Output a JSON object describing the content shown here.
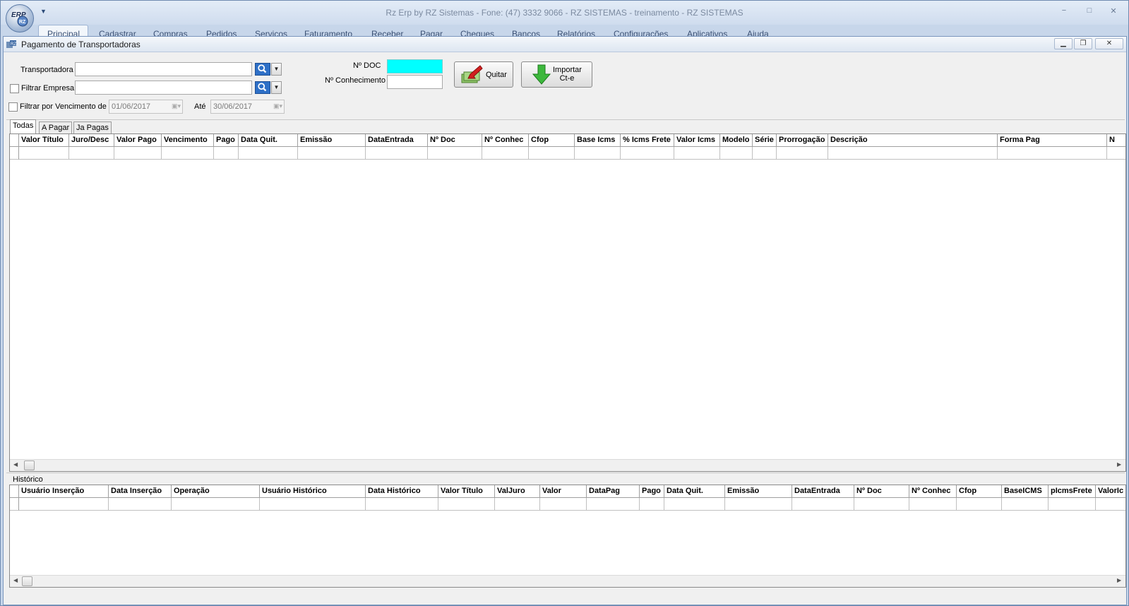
{
  "app": {
    "title": "Rz Erp by RZ Sistemas - Fone: (47) 3332 9066 - RZ SISTEMAS - treinamento - RZ SISTEMAS",
    "ribbon_tabs": [
      "Principal",
      "Cadastrar",
      "Compras",
      "Pedidos",
      "Serviços",
      "Faturamento",
      "Receber",
      "Pagar",
      "Cheques",
      "Bancos",
      "Relatórios",
      "Configurações",
      "Aplicativos",
      "Ajuda"
    ],
    "win_controls": {
      "minimize": "−",
      "maximize": "□",
      "close": "✕"
    }
  },
  "window": {
    "title": "Pagamento de Transportadoras",
    "controls": {
      "minimize": "▁",
      "restore": "❐",
      "close": "✕"
    }
  },
  "filters": {
    "transportadora_label": "Transportadora",
    "transportadora_value": "",
    "filtrar_empresa_label": "Filtrar Empresa",
    "filtrar_empresa_value": "",
    "filtrar_vencimento_label": "Filtrar por Vencimento de",
    "date_from": "01/06/2017",
    "ate_label": "Até",
    "date_to": "30/06/2017",
    "ndoc_label": "Nº DOC",
    "ndoc_value": "",
    "nconhecimento_label": "Nº Conhecimento",
    "nconhecimento_value": ""
  },
  "buttons": {
    "quitar": "Quitar",
    "importar_line1": "Importar",
    "importar_line2": "Ct-e"
  },
  "tabs": [
    "Todas",
    "A Pagar",
    "Ja Pagas"
  ],
  "main_grid": {
    "columns": [
      "Valor Título",
      "Juro/Desc",
      "Valor Pago",
      "Vencimento",
      "Pago",
      "Data Quit.",
      "Emissão",
      "DataEntrada",
      "Nº Doc",
      "Nº Conhec",
      "Cfop",
      "Base Icms",
      "% Icms Frete",
      "Valor Icms",
      "Modelo",
      "Série",
      "Prorrogação",
      "Descrição",
      "Forma Pag",
      "N"
    ]
  },
  "history": {
    "label": "Histórico",
    "columns": [
      "Usuário Inserção",
      "Data Inserção",
      "Operação",
      "Usuário Histórico",
      "Data Histórico",
      "Valor Título",
      "ValJuro",
      "Valor",
      "DataPag",
      "Pago",
      "Data Quit.",
      "Emissão",
      "DataEntrada",
      "Nº Doc",
      "Nº Conhec",
      "Cfop",
      "BaseICMS",
      "pIcmsFrete",
      "ValorIc"
    ]
  },
  "scroll": {
    "left": "◀",
    "right": "▶"
  }
}
